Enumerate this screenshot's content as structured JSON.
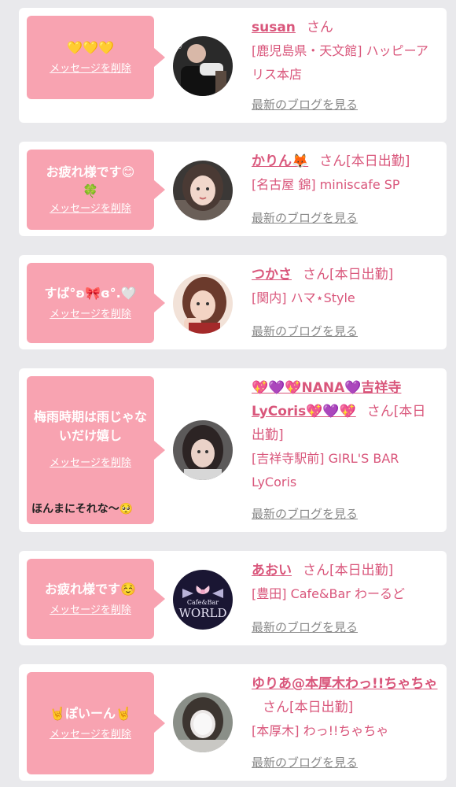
{
  "colors": {
    "accent": "#d9567b",
    "bubble": "#f8a3b1",
    "background": "#e9e9ec",
    "link_gray": "#888888"
  },
  "cards": [
    {
      "message": "💛💛💛",
      "delete_label": "メッセージを削除",
      "extra": "",
      "name": "susan",
      "name_suffix": "さん",
      "shop": "[鹿児島県・天文館] ハッピーアリス本店",
      "blog_link": "最新のブログを見る"
    },
    {
      "message": "お疲れ様です😊🍀",
      "delete_label": "メッセージを削除",
      "extra": "",
      "name": "かりん🦊",
      "name_suffix": "さん[本日出勤]",
      "shop": "[名古屋 錦] miniscafe SP",
      "blog_link": "最新のブログを見る"
    },
    {
      "message": "すば°ʚ🎀ɞ°.🤍",
      "delete_label": "メッセージを削除",
      "extra": "",
      "name": "つかさ",
      "name_suffix": "さん[本日出勤]",
      "shop": "[関内] ハマ⋆Style",
      "blog_link": "最新のブログを見る"
    },
    {
      "message": "梅雨時期は雨じゃないだけ嬉し",
      "delete_label": "メッセージを削除",
      "extra": "ほんまにそれな〜🥺",
      "name": "💖💜💖NANA💜吉祥寺LyCoris💖💜💖",
      "name_suffix": "さん[本日出勤]",
      "shop": "[吉祥寺駅前] GIRL'S BAR LyCoris",
      "blog_link": "最新のブログを見る"
    },
    {
      "message": "お疲れ様です☺️",
      "delete_label": "メッセージを削除",
      "extra": "",
      "name": "あおい",
      "name_suffix": "さん[本日出勤]",
      "shop": "[豊田] Cafe&Bar わーるど",
      "avatar_logo_small": "Cafe&Bar",
      "avatar_logo_big": "WORLD",
      "blog_link": "最新のブログを見る"
    },
    {
      "message": "🤘ぽいーん🤘",
      "delete_label": "メッセージを削除",
      "extra": "",
      "name": "ゆりあ@本厚木わっ!!ちゃちゃ",
      "name_suffix": "さん[本日出勤]",
      "shop": "[本厚木] わっ!!ちゃちゃ",
      "blog_link": "最新のブログを見る"
    }
  ]
}
